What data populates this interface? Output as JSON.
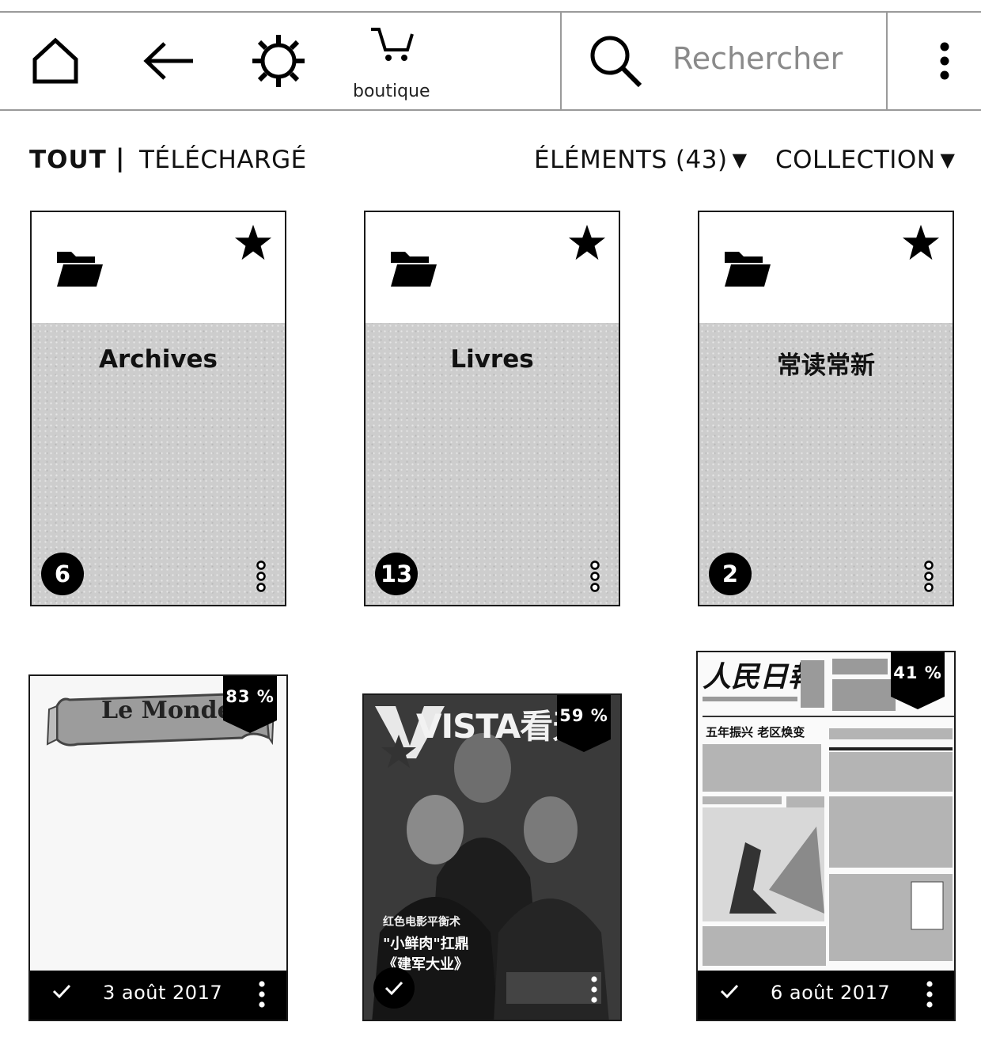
{
  "toolbar": {
    "home_icon": "home-icon",
    "back_icon": "back-arrow-icon",
    "settings_icon": "gear-icon",
    "store_label": "boutique",
    "search_placeholder": "Rechercher",
    "menu_icon": "kebab-icon"
  },
  "filters": {
    "all": "TOUT",
    "separator": "|",
    "downloaded": "TÉLÉCHARGÉ",
    "items": "ÉLÉMENTS (43)",
    "sort": "COLLECTION"
  },
  "collections": [
    {
      "title": "Archives",
      "count": "6"
    },
    {
      "title": "Livres",
      "count": "13"
    },
    {
      "title": "常读常新",
      "count": "2"
    }
  ],
  "items": [
    {
      "cover_title": "Le Monde",
      "progress": "83 %",
      "date": "3 août 2017"
    },
    {
      "cover_title": "VISTA看天",
      "progress": "59 %",
      "cover_text_1": "红色电影平衡术",
      "cover_text_2": "\"小鲜肉\"扛鼎",
      "cover_text_3": "《建军大业》"
    },
    {
      "cover_title": "人民日報",
      "progress": "41 %",
      "date": "6 août 2017",
      "headline": "五年振兴 老区焕变"
    }
  ],
  "colors": {
    "ink": "#000000",
    "tile_gray": "#cdcdcd",
    "divider": "#9a9a9a"
  }
}
